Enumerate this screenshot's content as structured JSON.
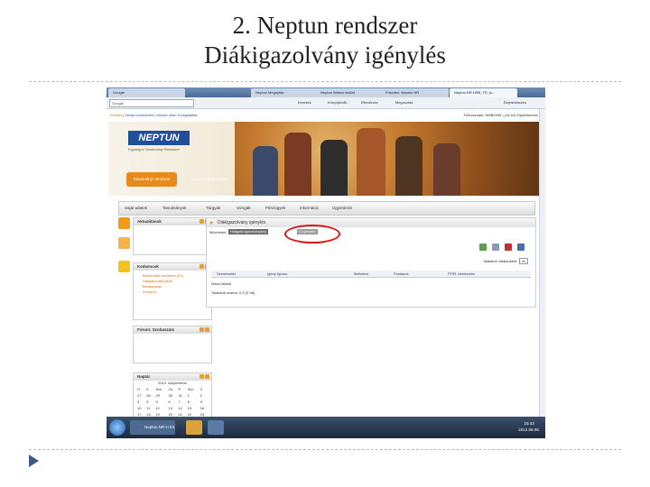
{
  "slide": {
    "title_line1": "2. Neptun rendszer",
    "title_line2": "Diákigazolvány igénylés"
  },
  "browser": {
    "tabs": [
      "Google",
      "Neptun Megújítás",
      "Neptun Webes felület",
      "Frissítés: Neptun NR",
      "Neptun.NR.HSB_TR_is..."
    ],
    "search_placeholder": "Google",
    "toolbar_items": [
      "Keresés",
      "Könyvjelzők",
      "Ellenőrzés",
      "Megosztás",
      "Bejelentkezés"
    ]
  },
  "neptun": {
    "topline_links": [
      "Kilépés",
      "Tanári rendszerek",
      "Neptun Web Szolgáltatás"
    ],
    "user_info": "Felhasználó: NMBZNW  |  (14:42)  Kijelentkezés",
    "logo": "NEPTUN",
    "logo_sub": "Egységes Tanulmányi Rendszer",
    "header_tabs": [
      "Tanulmányi rendszer",
      "Neptun Meet Street"
    ],
    "menu": [
      "Saját adatok",
      "Tanulmányok",
      "Tárgyak",
      "Vizsgák",
      "Pénzügyek",
      "Információ",
      "Ügyintézés"
    ],
    "panels": {
      "news": "Aktualitások",
      "favorites": "Kedvencek",
      "favorite_items": [
        "Benfentnél üzenetek (27)",
        "Hallgatói átnyújtás",
        "Beiratkozás",
        "Órarend"
      ],
      "forum": "Fórum: Szobaszám",
      "calendar": "Naptár",
      "calendar_month": "2012. szeptember",
      "calendar_days": [
        "H",
        "K",
        "Sze",
        "Cs",
        "P",
        "Szo",
        "V"
      ],
      "calendar_rows": [
        [
          "27",
          "28",
          "29",
          "30",
          "31",
          "1",
          "2"
        ],
        [
          "3",
          "4",
          "5",
          "6",
          "7",
          "8",
          "9"
        ],
        [
          "10",
          "11",
          "12",
          "13",
          "14",
          "15",
          "16"
        ],
        [
          "17",
          "18",
          "19",
          "20",
          "21",
          "22",
          "23"
        ]
      ]
    },
    "main": {
      "title": "Diákigazolvány igénylés",
      "breadcrumb": "Műveletek:",
      "subtabs": [
        "Hallgatói igazolványkép",
        "Új igénylés"
      ],
      "per_page_label": "Találatok oldalanként:",
      "per_page_value": "20",
      "columns": [
        "Szemeszter",
        "Igény típusa",
        "Befizetve",
        "Postázva",
        "PTIR. beérkezés"
      ],
      "empty_text": "Nincs találat",
      "count_text": "Találatok száma: 0-0 (0 db)"
    }
  },
  "taskbar": {
    "items": [
      "Neptun.NR.H D1",
      "Megosztva",
      ""
    ],
    "clock_time": "15:43",
    "clock_date": "2012.08.08."
  },
  "colors": {
    "accent_orange": "#f08a10",
    "neptun_blue": "#1f4e9a",
    "highlight_red": "#e01010"
  }
}
